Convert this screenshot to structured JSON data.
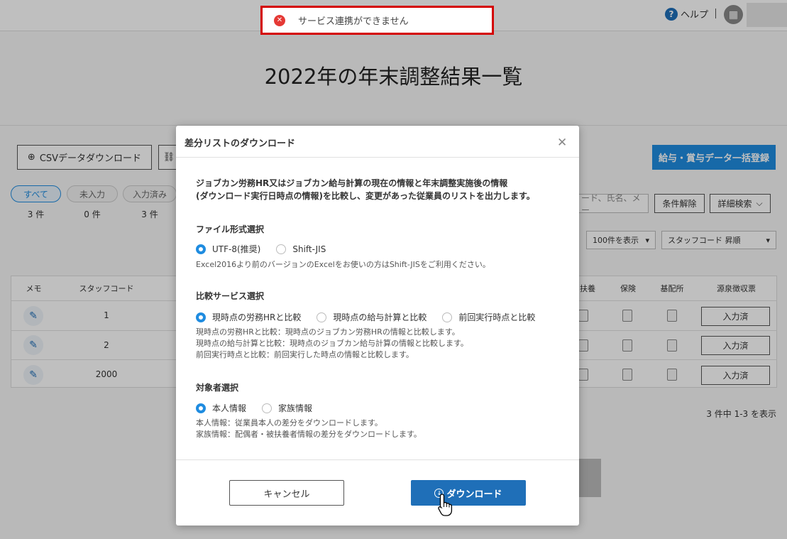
{
  "toast": {
    "message": "サービス連携ができません"
  },
  "header": {
    "help_label": "ヘルプ"
  },
  "page": {
    "title": "2022年の年末調整結果一覧"
  },
  "toolbar": {
    "csv_download_label": "CSVデータダウンロード",
    "bulk_register_label": "給与・賞与データ一括登録",
    "search_placeholder": "ード、氏名、メー",
    "clear_conditions_label": "条件解除",
    "advanced_search_label": "詳細検索",
    "per_page_select": "100件を表示",
    "sort_select": "スタッフコード 昇順"
  },
  "filters": [
    {
      "label": "すべて",
      "count": "3 件"
    },
    {
      "label": "未入力",
      "count": "0 件"
    },
    {
      "label": "入力済み",
      "count": "3 件"
    }
  ],
  "table": {
    "headers": {
      "memo": "メモ",
      "staff_code": "スタッフコード",
      "dependents": "扶養",
      "insurance": "保険",
      "spouse": "基配所",
      "withholding": "源泉徴収票"
    },
    "rows": [
      {
        "code": "1",
        "status": "入力済"
      },
      {
        "code": "2",
        "status": "入力済"
      },
      {
        "code": "2000",
        "status": "入力済"
      }
    ]
  },
  "pager": {
    "summary": "3 件中 1-3 を表示"
  },
  "modal": {
    "title": "差分リストのダウンロード",
    "description_line1": "ジョブカン労務HR又はジョブカン給与計算の現在の情報と年末調整実施後の情報",
    "description_line2": "(ダウンロード実行日時点の情報)を比較し、変更があった従業員のリストを出力します。",
    "file_format": {
      "label": "ファイル形式選択",
      "options": [
        "UTF-8(推奨)",
        "Shift-JIS"
      ],
      "note": "Excel2016より前のバージョンのExcelをお使いの方はShift-JISをご利用ください。"
    },
    "compare_service": {
      "label": "比較サービス選択",
      "options": [
        "現時点の労務HRと比較",
        "現時点の給与計算と比較",
        "前回実行時点と比較"
      ],
      "notes": [
        "現時点の労務HRと比較：現時点のジョブカン労務HRの情報と比較します。",
        "現時点の給与計算と比較：現時点のジョブカン給与計算の情報と比較します。",
        "前回実行時点と比較：前回実行した時点の情報と比較します。"
      ]
    },
    "target": {
      "label": "対象者選択",
      "options": [
        "本人情報",
        "家族情報"
      ],
      "notes": [
        "本人情報：従業員本人の差分をダウンロードします。",
        "家族情報：配偶者・被扶養者情報の差分をダウンロードします。"
      ]
    },
    "cancel_label": "キャンセル",
    "download_label": "ダウンロード"
  }
}
